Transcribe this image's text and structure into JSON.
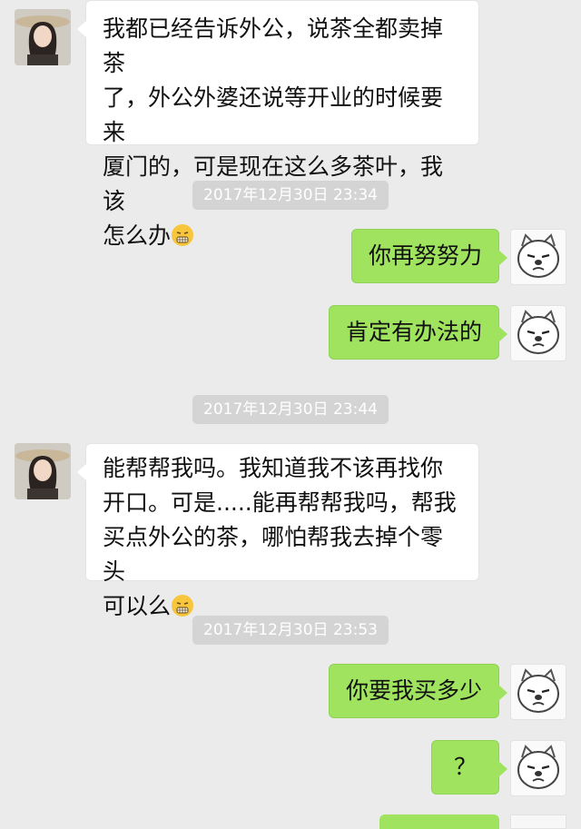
{
  "messages": [
    {
      "side": "left",
      "text_lines": [
        "我都已经告诉外公，说茶全都卖掉茶",
        "了，外公外婆还说等开业的时候要来",
        "厦门的，可是现在这么多茶叶，我该",
        "怎么办"
      ],
      "emoji": "grimace-emoji"
    },
    {
      "timestamp": "2017年12月30日 23:34"
    },
    {
      "side": "right",
      "text": "你再努努力"
    },
    {
      "side": "right",
      "text": "肯定有办法的"
    },
    {
      "timestamp": "2017年12月30日 23:44"
    },
    {
      "side": "left",
      "text_lines": [
        "能帮帮我吗。我知道我不该再找你",
        "开口。可是.....能再帮帮我吗，帮我",
        "买点外公的茶，哪怕帮我去掉个零头",
        "可以么"
      ],
      "emoji": "grimace-emoji"
    },
    {
      "timestamp": "2017年12月30日 23:53"
    },
    {
      "side": "right",
      "text": "你要我买多少"
    },
    {
      "side": "right",
      "text": "？"
    }
  ],
  "colors": {
    "sent_bubble": "#9fe35f",
    "received_bubble": "#ffffff",
    "timestamp_bg": "#d4d4d4",
    "background": "#ebebeb"
  },
  "icons": {
    "left_avatar": "woman-with-hat-avatar",
    "right_avatar": "cartoon-bear-face-avatar"
  }
}
